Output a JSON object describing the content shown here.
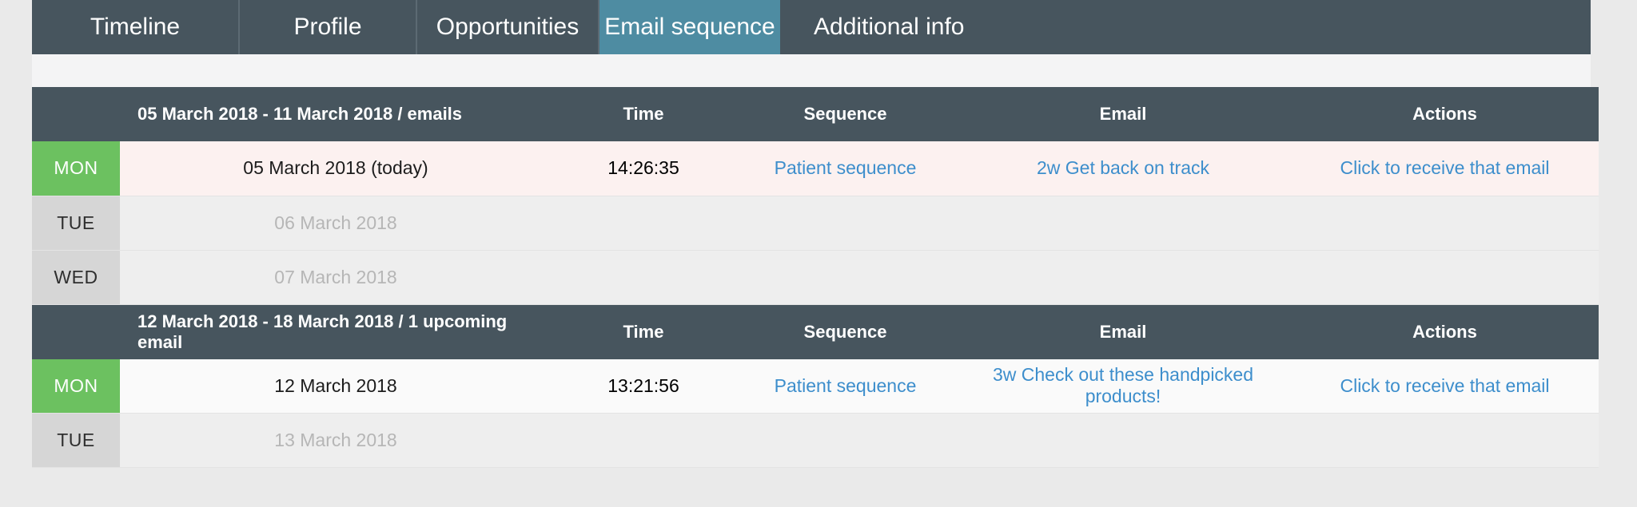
{
  "tabs": [
    {
      "label": "Timeline",
      "active": false
    },
    {
      "label": "Profile",
      "active": false
    },
    {
      "label": "Opportunities",
      "active": false
    },
    {
      "label": "Email sequence",
      "active": true
    },
    {
      "label": "Additional info",
      "active": false
    }
  ],
  "columns": {
    "time": "Time",
    "sequence": "Sequence",
    "email": "Email",
    "actions": "Actions"
  },
  "colors": {
    "tab_bar": "#47555e",
    "tab_active": "#4e8ca2",
    "header": "#47555e",
    "day_active": "#6cc160",
    "day_inactive": "#d6d6d6",
    "link": "#3d8ecc",
    "row_today": "#fcf1f0",
    "row_empty": "#eeeeee"
  },
  "sections": [
    {
      "range": "05 March 2018 - 11 March 2018 / emails",
      "rows": [
        {
          "day": "MON",
          "day_state": "active",
          "date": "05 March 2018 (today)",
          "time": "14:26:35",
          "sequence": "Patient sequence",
          "email": "2w Get back on track",
          "action": "Click to receive that email",
          "row_state": "today"
        },
        {
          "day": "TUE",
          "day_state": "inactive",
          "date": "06 March 2018",
          "time": "",
          "sequence": "",
          "email": "",
          "action": "",
          "row_state": "empty"
        },
        {
          "day": "WED",
          "day_state": "inactive",
          "date": "07 March 2018",
          "time": "",
          "sequence": "",
          "email": "",
          "action": "",
          "row_state": "empty"
        }
      ]
    },
    {
      "range": "12 March 2018 - 18 March 2018 / 1 upcoming email",
      "rows": [
        {
          "day": "MON",
          "day_state": "active",
          "date": "12 March 2018",
          "time": "13:21:56",
          "sequence": "Patient sequence",
          "email": "3w Check out these handpicked products!",
          "action": "Click to receive that email",
          "row_state": "upcoming"
        },
        {
          "day": "TUE",
          "day_state": "inactive",
          "date": "13 March 2018",
          "time": "",
          "sequence": "",
          "email": "",
          "action": "",
          "row_state": "empty"
        }
      ]
    }
  ]
}
